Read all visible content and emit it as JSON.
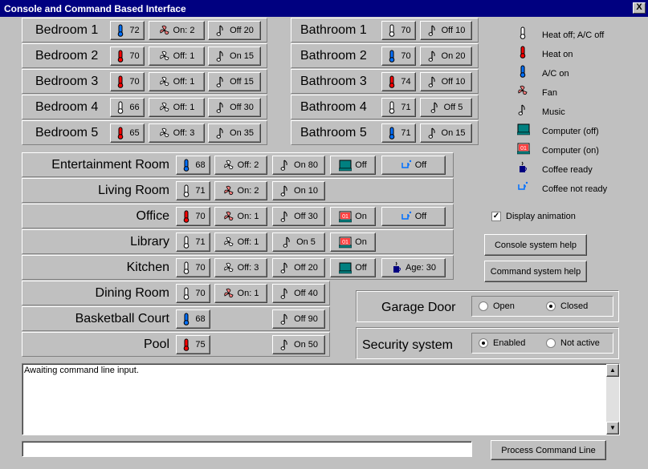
{
  "window": {
    "title": "Console and Command Based Interface",
    "close": "X"
  },
  "colors": {
    "heat": "#ff0000",
    "ac": "#0070ff",
    "fan": "#ff8080",
    "computer": "#008080"
  },
  "bedrooms": [
    {
      "name": "Bedroom 1",
      "temp": "72",
      "temp_icon": "ac",
      "fan": "On: 2",
      "fan_on": true,
      "music": "Off 20"
    },
    {
      "name": "Bedroom 2",
      "temp": "70",
      "temp_icon": "heat",
      "fan": "Off: 1",
      "fan_on": false,
      "music": "On 15"
    },
    {
      "name": "Bedroom 3",
      "temp": "70",
      "temp_icon": "heat",
      "fan": "Off: 1",
      "fan_on": false,
      "music": "Off 15"
    },
    {
      "name": "Bedroom 4",
      "temp": "66",
      "temp_icon": "off",
      "fan": "Off: 1",
      "fan_on": false,
      "music": "Off 30"
    },
    {
      "name": "Bedroom 5",
      "temp": "65",
      "temp_icon": "heat",
      "fan": "Off: 3",
      "fan_on": false,
      "music": "On 35"
    }
  ],
  "bathrooms": [
    {
      "name": "Bathroom 1",
      "temp": "70",
      "temp_icon": "off",
      "music": "Off 10"
    },
    {
      "name": "Bathroom 2",
      "temp": "70",
      "temp_icon": "ac",
      "music": "On 20"
    },
    {
      "name": "Bathroom 3",
      "temp": "74",
      "temp_icon": "heat",
      "music": "Off 10"
    },
    {
      "name": "Bathroom 4",
      "temp": "71",
      "temp_icon": "off",
      "music": "Off 5"
    },
    {
      "name": "Bathroom 5",
      "temp": "71",
      "temp_icon": "ac",
      "music": "On 15"
    }
  ],
  "rooms": [
    {
      "name": "Entertainment Room",
      "temp": "68",
      "temp_icon": "ac",
      "fan": "Off: 2",
      "fan_on": false,
      "music": "On 80",
      "computer": "Off",
      "computer_on": false,
      "coffee": "Off"
    },
    {
      "name": "Living Room",
      "temp": "71",
      "temp_icon": "off",
      "fan": "On: 2",
      "fan_on": true,
      "music": "On 10"
    },
    {
      "name": "Office",
      "temp": "70",
      "temp_icon": "heat",
      "fan": "On: 1",
      "fan_on": true,
      "music": "Off 30",
      "computer": "On",
      "computer_on": true,
      "coffee": "Off"
    },
    {
      "name": "Library",
      "temp": "71",
      "temp_icon": "off",
      "fan": "Off: 1",
      "fan_on": false,
      "music": "On 5",
      "computer": "On",
      "computer_on": true
    },
    {
      "name": "Kitchen",
      "temp": "70",
      "temp_icon": "off",
      "fan": "Off: 3",
      "fan_on": false,
      "music": "Off 20",
      "computer": "Off",
      "computer_on": false,
      "coffee": "Age: 30",
      "coffee_ready": true
    }
  ],
  "rooms2": [
    {
      "name": "Dining Room",
      "temp": "70",
      "temp_icon": "off",
      "fan": "On: 1",
      "fan_on": true,
      "music": "Off 40"
    },
    {
      "name": "Basketball Court",
      "temp": "68",
      "temp_icon": "ac",
      "music": "Off 90"
    },
    {
      "name": "Pool",
      "temp": "75",
      "temp_icon": "heat",
      "music": "On 50"
    }
  ],
  "legend": [
    {
      "icon": "off",
      "label": "Heat off; A/C off"
    },
    {
      "icon": "heat",
      "label": "Heat on"
    },
    {
      "icon": "ac",
      "label": "A/C on"
    },
    {
      "icon": "fan",
      "label": "Fan"
    },
    {
      "icon": "music",
      "label": "Music"
    },
    {
      "icon": "comp-off",
      "label": "Computer (off)"
    },
    {
      "icon": "comp-on",
      "label": "Computer (on)"
    },
    {
      "icon": "coffee-ready",
      "label": "Coffee ready"
    },
    {
      "icon": "coffee-not",
      "label": "Coffee not ready"
    }
  ],
  "display_animation": "Display animation",
  "console_help": "Console system help",
  "command_help": "Command system help",
  "garage": {
    "label": "Garage Door",
    "opt1": "Open",
    "opt2": "Closed",
    "selected": "Closed"
  },
  "security": {
    "label": "Security system",
    "opt1": "Enabled",
    "opt2": "Not active",
    "selected": "Enabled"
  },
  "log": "Awaiting command line input.",
  "command_input": "",
  "process_button": "Process Command Line"
}
